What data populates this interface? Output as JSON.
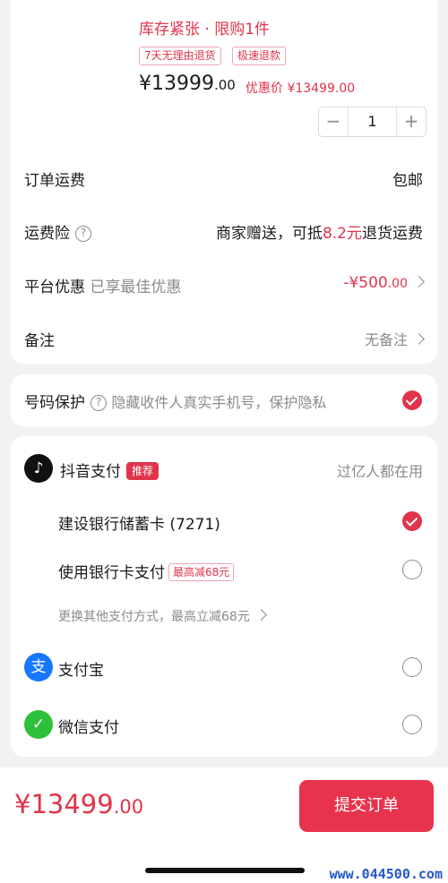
{
  "product": {
    "stock_notice": "库存紧张 · 限购1件",
    "tags": [
      "7天无理由退货",
      "极速退款"
    ],
    "price_symbol": "¥",
    "price_main": "13999",
    "price_cents": ".00",
    "promo_label": "优惠价",
    "promo_price": "¥13499.00",
    "quantity": "1",
    "minus": "−",
    "plus": "+"
  },
  "order": {
    "shipping_label": "订单运费",
    "shipping_value": "包邮",
    "insurance_label": "运费险",
    "insurance_help": "?",
    "insurance_text_a": "商家赠送，可抵",
    "insurance_amount": "8.2元",
    "insurance_text_b": "退货运费",
    "platform_label": "平台优惠",
    "platform_sub": "已享最佳优惠",
    "platform_value": "-¥500",
    "platform_cents": ".00",
    "remark_label": "备注",
    "remark_value": "无备注"
  },
  "privacy": {
    "label": "号码保护",
    "help": "?",
    "text": "隐藏收件人真实手机号，保护隐私",
    "checked": true
  },
  "payment": {
    "douyin_label": "抖音支付",
    "douyin_badge": "推荐",
    "douyin_slogan": "过亿人都在用",
    "ccb_label": "建设银行储蓄卡 (7271)",
    "bankcard_label": "使用银行卡支付",
    "bankcard_badge": "最高减68元",
    "other_methods": "更换其他支付方式，最高立减68元",
    "alipay_label": "支付宝",
    "wechat_label": "微信支付",
    "icons": {
      "douyin": "douyin-logo-icon",
      "alipay": "alipay-logo-icon",
      "wechat": "wechat-pay-logo-icon"
    }
  },
  "footer": {
    "total_symbol": "¥",
    "total_main": "13499",
    "total_cents": ".00",
    "submit_label": "提交订单",
    "watermark": "www.044500.com"
  },
  "colors": {
    "accent": "#e0344b",
    "alipay": "#1677ff",
    "wechat": "#2dc13b"
  }
}
